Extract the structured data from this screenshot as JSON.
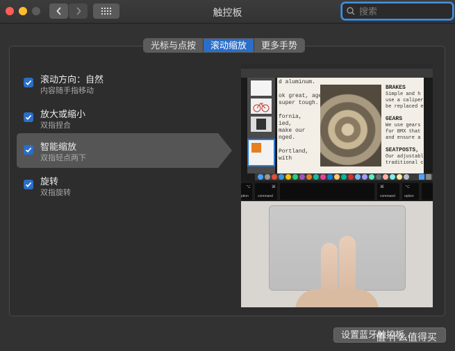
{
  "window": {
    "title": "触控板",
    "search_placeholder": "搜索"
  },
  "tabs": [
    {
      "label": "光标与点按",
      "active": false
    },
    {
      "label": "滚动缩放",
      "active": true
    },
    {
      "label": "更多手势",
      "active": false
    }
  ],
  "options": [
    {
      "title": "滚动方向：自然",
      "subtitle": "内容随手指移动",
      "checked": true,
      "selected": false
    },
    {
      "title": "放大或缩小",
      "subtitle": "双指捏合",
      "checked": true,
      "selected": false
    },
    {
      "title": "智能缩放",
      "subtitle": "双指轻点两下",
      "checked": true,
      "selected": true
    },
    {
      "title": "旋转",
      "subtitle": "双指旋转",
      "checked": true,
      "selected": false
    }
  ],
  "preview": {
    "doc_lines_left": [
      "d aluminum.",
      "",
      "ok great, age",
      "super tough.",
      "",
      "fornia,",
      "ied,",
      "make our",
      "nged.",
      "",
      "Portland,",
      "with"
    ],
    "sections": [
      {
        "heading": "BRAKES",
        "body": "Simple and h\nuse a caliper\nbe replaced e"
      },
      {
        "heading": "GEARS",
        "body": "We use gears\nfor BMX that\nand ensure a"
      },
      {
        "heading": "SEATPOSTS,",
        "body": "Our adjustable\ntraditional c"
      }
    ],
    "key_left_sym": "⌘",
    "key_left_label": "command",
    "key_right_sym": "⌘",
    "key_right_label": "command",
    "key_option_label": "option",
    "key_option_left": "ption"
  },
  "bluetooth_button": "设置蓝牙触控板…",
  "watermark": "值 什么值得买",
  "colors": {
    "accent": "#2a6ec9",
    "close": "#ff5f57",
    "minimize": "#febc2e"
  }
}
